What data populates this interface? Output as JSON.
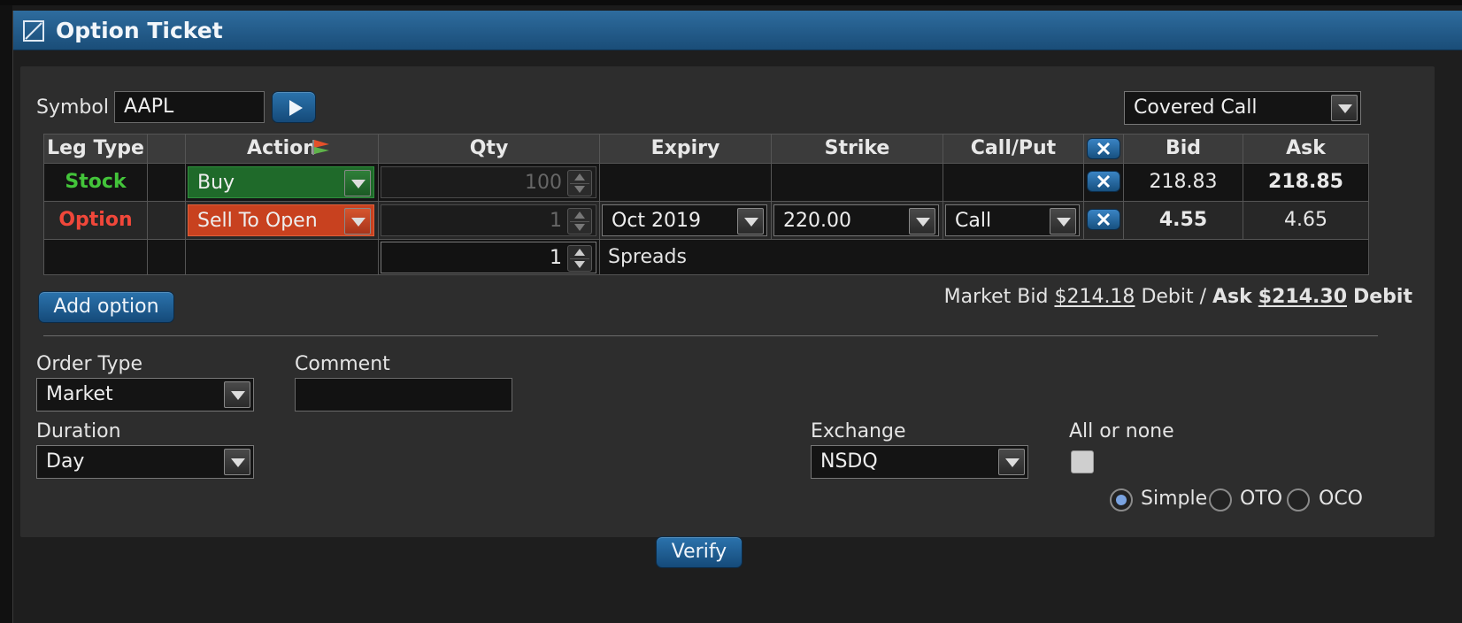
{
  "window": {
    "title": "Option Ticket"
  },
  "symbol": {
    "label": "Symbol",
    "value": "AAPL"
  },
  "strategy": {
    "selected": "Covered Call"
  },
  "legs_table": {
    "headers": [
      "Leg Type",
      "Action",
      "Qty",
      "Expiry",
      "Strike",
      "Call/Put",
      "Bid",
      "Ask"
    ],
    "rows": [
      {
        "leg_type": "Stock",
        "action": "Buy",
        "qty": "100",
        "expiry": "",
        "strike": "",
        "call_put": "",
        "bid": "218.83",
        "ask": "218.85"
      },
      {
        "leg_type": "Option",
        "action": "Sell To Open",
        "qty": "1",
        "expiry": "Oct 2019",
        "strike": "220.00",
        "call_put": "Call",
        "bid": "4.55",
        "ask": "4.65"
      }
    ],
    "spreads": {
      "qty": "1",
      "label": "Spreads"
    }
  },
  "add_option_label": "Add option",
  "market": {
    "bid_label": "Market Bid",
    "bid_value": "$214.18",
    "bid_suffix": "Debit /",
    "ask_label": "Ask",
    "ask_value": "$214.30",
    "ask_suffix": "Debit"
  },
  "order_type": {
    "label": "Order Type",
    "value": "Market"
  },
  "comment": {
    "label": "Comment",
    "value": ""
  },
  "duration": {
    "label": "Duration",
    "value": "Day"
  },
  "exchange": {
    "label": "Exchange",
    "value": "NSDQ"
  },
  "all_or_none": {
    "label": "All or none",
    "checked": false
  },
  "order_mode": {
    "options": [
      "Simple",
      "OTO",
      "OCO"
    ],
    "selected": "Simple"
  },
  "verify_label": "Verify",
  "colors": {
    "stock": "#43c43a",
    "option": "#f0473a",
    "buy_bg": "#1f6a2a",
    "sell_bg": "#c8411f",
    "accent": "#1e5a8c"
  }
}
